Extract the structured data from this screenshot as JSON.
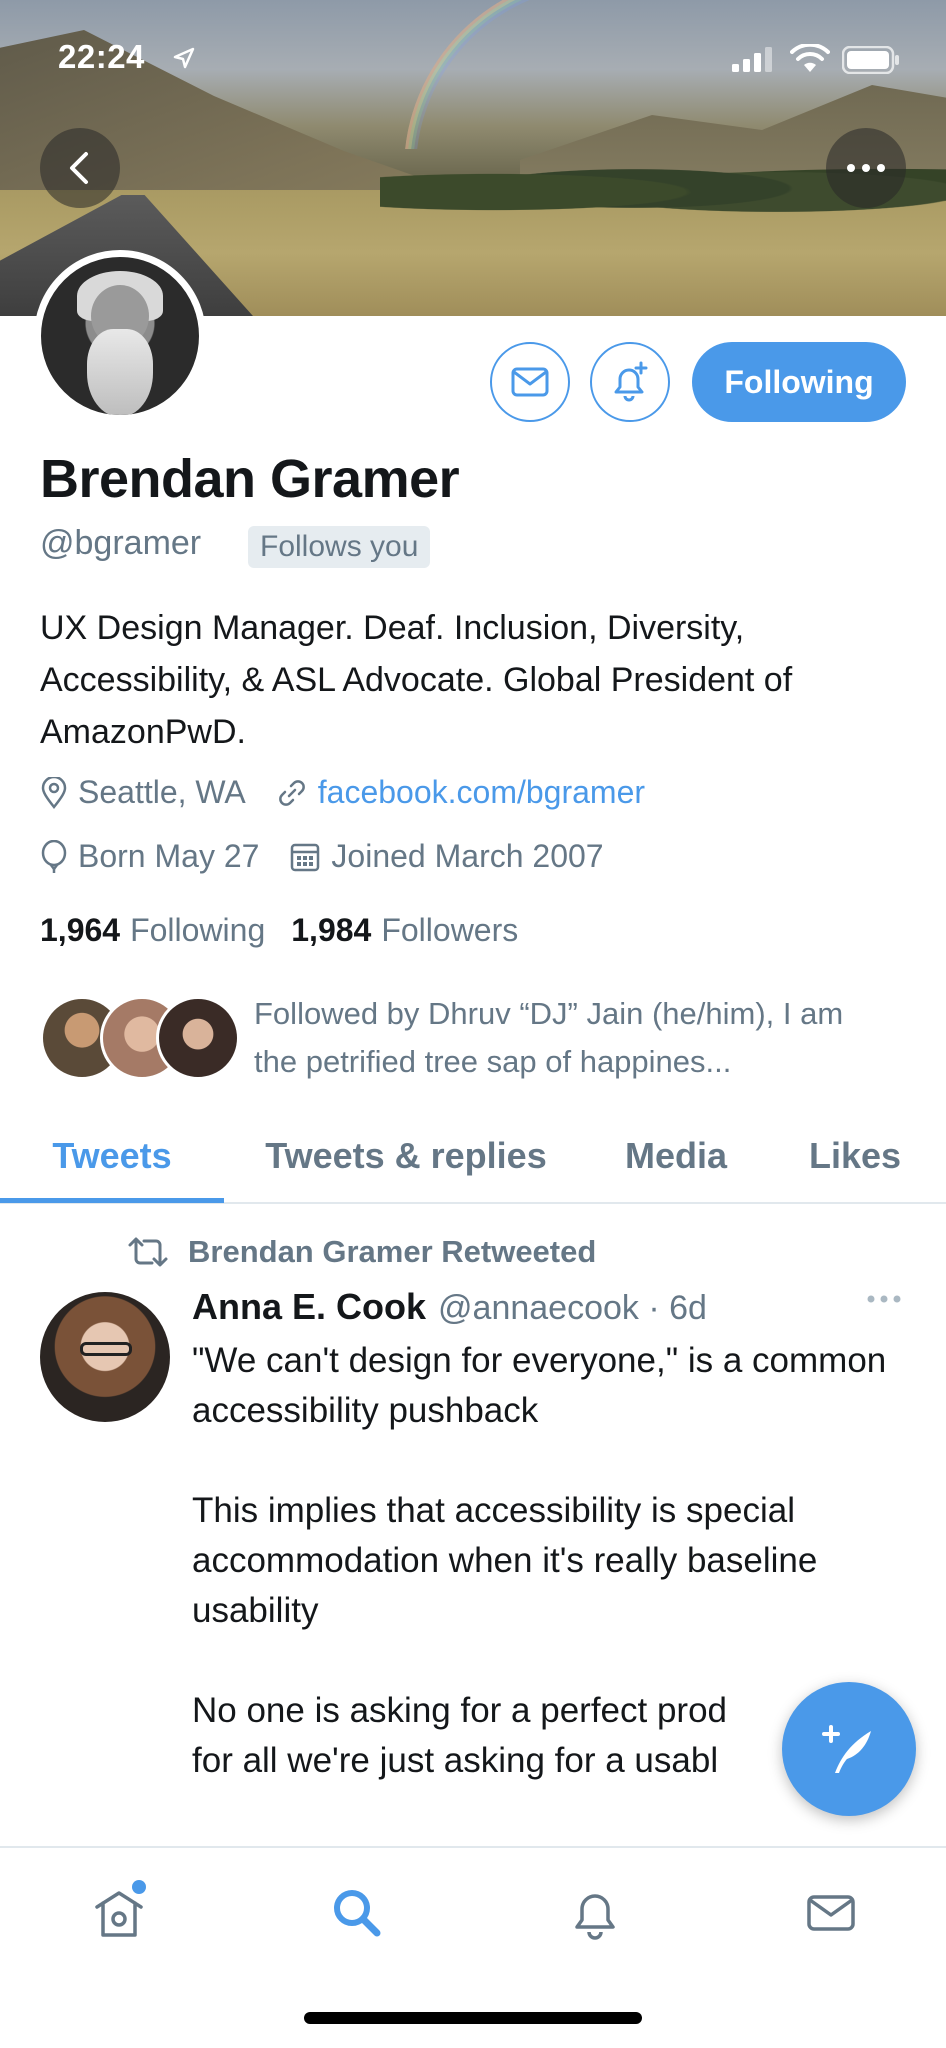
{
  "status_bar": {
    "time": "22:24"
  },
  "profile": {
    "name": "Brendan Gramer",
    "handle": "@bgramer",
    "follows_you_label": "Follows you",
    "bio": "UX Design Manager. Deaf. Inclusion, Diversity, Accessibility, & ASL Advocate. Global President of AmazonPwD.",
    "location": "Seattle, WA",
    "website": "facebook.com/bgramer",
    "birthday": "Born May 27",
    "joined": "Joined March 2007",
    "following_count": "1,964",
    "following_label": "Following",
    "followers_count": "1,984",
    "followers_label": "Followers",
    "followed_by": "Followed by Dhruv “DJ” Jain (he/him), I am the petrified tree sap of happines..."
  },
  "actions": {
    "following_button": "Following"
  },
  "tabs": [
    {
      "label": "Tweets",
      "active": true
    },
    {
      "label": "Tweets & replies",
      "active": false
    },
    {
      "label": "Media",
      "active": false
    },
    {
      "label": "Likes",
      "active": false
    }
  ],
  "tweet": {
    "retweeted_by": "Brendan Gramer Retweeted",
    "author_name": "Anna E. Cook",
    "author_handle": "@annaecook · 6d",
    "text": "\"We can't design for everyone,\" is a common accessibility pushback\n\nThis implies that accessibility is special accommodation when it's really baseline usability\n\nNo one is asking for a perfect prod\nfor all we're just asking for a usabl"
  },
  "colors": {
    "accent": "#4a99e9",
    "secondary_text": "#657786",
    "primary_text": "#14171a"
  },
  "icons": {
    "back": "chevron-left-icon",
    "more": "more-horizontal-icon",
    "mail": "mail-icon",
    "notify": "bell-plus-icon",
    "location": "location-pin-icon",
    "link": "link-icon",
    "birthday": "balloon-icon",
    "calendar": "calendar-icon",
    "retweet": "retweet-icon",
    "compose": "compose-tweet-icon",
    "home": "home-icon",
    "search": "search-icon",
    "notifications": "bell-icon",
    "messages": "messages-icon"
  }
}
